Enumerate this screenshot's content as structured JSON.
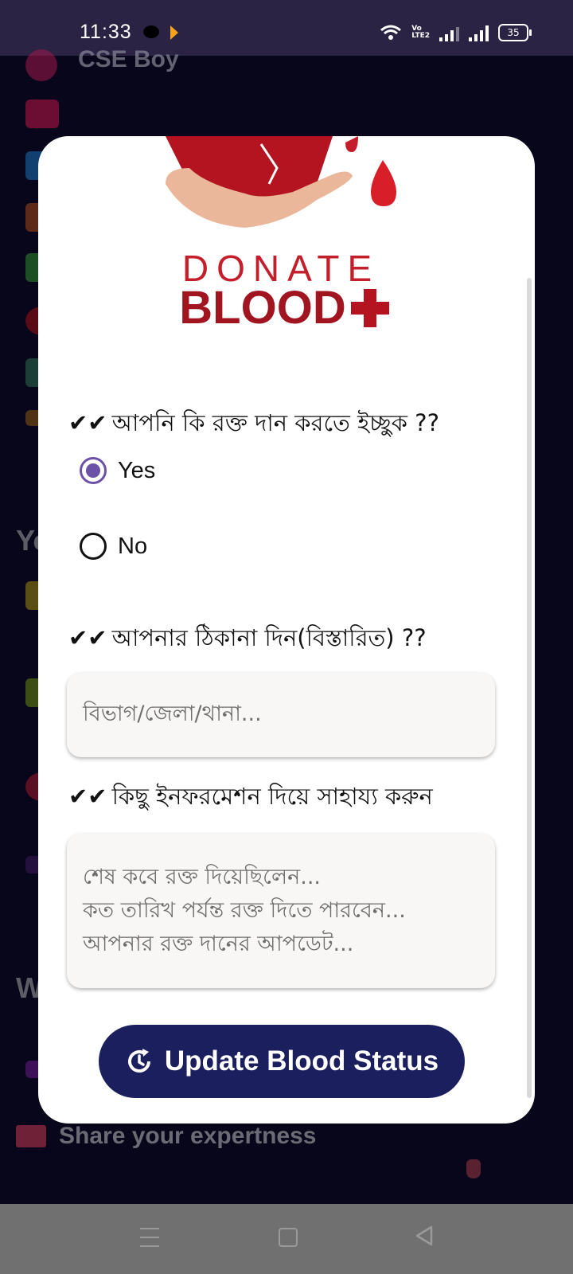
{
  "status_bar": {
    "time": "11:33",
    "volte": "Vo\nLTE2",
    "battery": "35"
  },
  "background": {
    "profile_name": "CSE Boy",
    "section_letters": [
      "Yo",
      "W"
    ],
    "share_label": "Share your expertness"
  },
  "dialog": {
    "logo_line1": "DONATE",
    "logo_line2": "BLOOD",
    "q1": {
      "check": "✔✔",
      "text": "আপনি কি রক্ত দান করতে ইচ্ছুক ??"
    },
    "options": [
      {
        "label": "Yes",
        "selected": true
      },
      {
        "label": "No",
        "selected": false
      }
    ],
    "q2": {
      "check": "✔✔",
      "text": "আপনার ঠিকানা দিন(বিস্তারিত) ??"
    },
    "address_placeholder": "বিভাগ/জেলা/থানা...",
    "q3": {
      "check": "✔✔",
      "text": "কিছু ইনফরমেশন দিয়ে সাহায্য করুন"
    },
    "info_placeholder": "শেষ কবে রক্ত দিয়েছিলেন...\nকত তারিখ পর্যন্ত রক্ত দিতে পারবেন...\nআপনার রক্ত দানের আপডেট...",
    "button_label": "Update Blood Status"
  },
  "colors": {
    "accent": "#6b52a7",
    "button": "#1c1f5e",
    "brand_red": "#c41e2a"
  }
}
